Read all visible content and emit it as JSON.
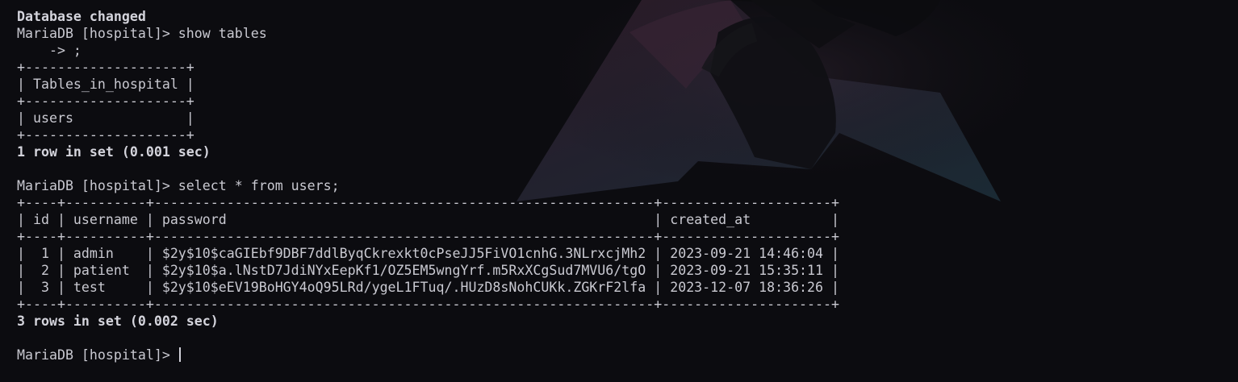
{
  "terminal": {
    "lines": [
      {
        "text": "Database changed",
        "bold": true
      },
      {
        "text": "MariaDB [hospital]> show tables"
      },
      {
        "text": "    -> ;"
      },
      {
        "text": "+--------------------+"
      },
      {
        "text": "| Tables_in_hospital |"
      },
      {
        "text": "+--------------------+"
      },
      {
        "text": "| users              |"
      },
      {
        "text": "+--------------------+"
      },
      {
        "text": "1 row in set (0.001 sec)",
        "bold": true
      },
      {
        "text": ""
      },
      {
        "text": "MariaDB [hospital]> select * from users;"
      },
      {
        "text": "+----+----------+--------------------------------------------------------------+---------------------+"
      },
      {
        "text": "| id | username | password                                                     | created_at          |"
      },
      {
        "text": "+----+----------+--------------------------------------------------------------+---------------------+"
      },
      {
        "text": "|  1 | admin    | $2y$10$caGIEbf9DBF7ddlByqCkrexkt0cPseJJ5FiVO1cnhG.3NLrxcjMh2 | 2023-09-21 14:46:04 |"
      },
      {
        "text": "|  2 | patient  | $2y$10$a.lNstD7JdiNYxEepKf1/OZ5EM5wngYrf.m5RxXCgSud7MVU6/tgO | 2023-09-21 15:35:11 |"
      },
      {
        "text": "|  3 | test     | $2y$10$eEV19BoHGY4oQ95LRd/ygeL1FTuq/.HUzD8sNohCUKk.ZGKrF2lfa | 2023-12-07 18:36:26 |"
      },
      {
        "text": "+----+----------+--------------------------------------------------------------+---------------------+"
      },
      {
        "text": "3 rows in set (0.002 sec)",
        "bold": true
      },
      {
        "text": ""
      }
    ],
    "prompt": "MariaDB [hospital]> "
  },
  "colors": {
    "background": "#0c0c10",
    "text": "#c9c9d1"
  }
}
